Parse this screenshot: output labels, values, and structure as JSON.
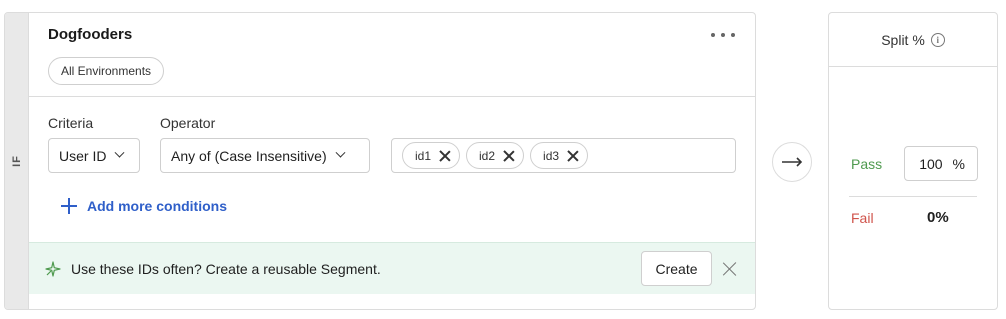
{
  "rule": {
    "if_label": "IF",
    "segment_title": "Dogfooders",
    "environment_pill": "All Environments",
    "criteria": {
      "label": "Criteria",
      "value": "User ID"
    },
    "operator": {
      "label": "Operator",
      "value": "Any of (Case Insensitive)"
    },
    "values": [
      "id1",
      "id2",
      "id3"
    ],
    "add_conditions_label": "Add more conditions",
    "banner": {
      "text": "Use these IDs often? Create a reusable Segment.",
      "create_label": "Create"
    }
  },
  "split": {
    "header": "Split %",
    "info_glyph": "i",
    "pass_label": "Pass",
    "pass_value": "100",
    "pass_unit": "%",
    "fail_label": "Fail",
    "fail_value": "0%"
  },
  "colors": {
    "pass": "#4f9a4f",
    "fail": "#d0544c",
    "link": "#2f5fc9",
    "banner_bg": "#ebf7f1"
  },
  "icons": [
    "more-icon",
    "chevron-down-icon",
    "close-icon",
    "plus-icon",
    "sparkle-icon",
    "arrow-right-icon",
    "info-icon"
  ]
}
